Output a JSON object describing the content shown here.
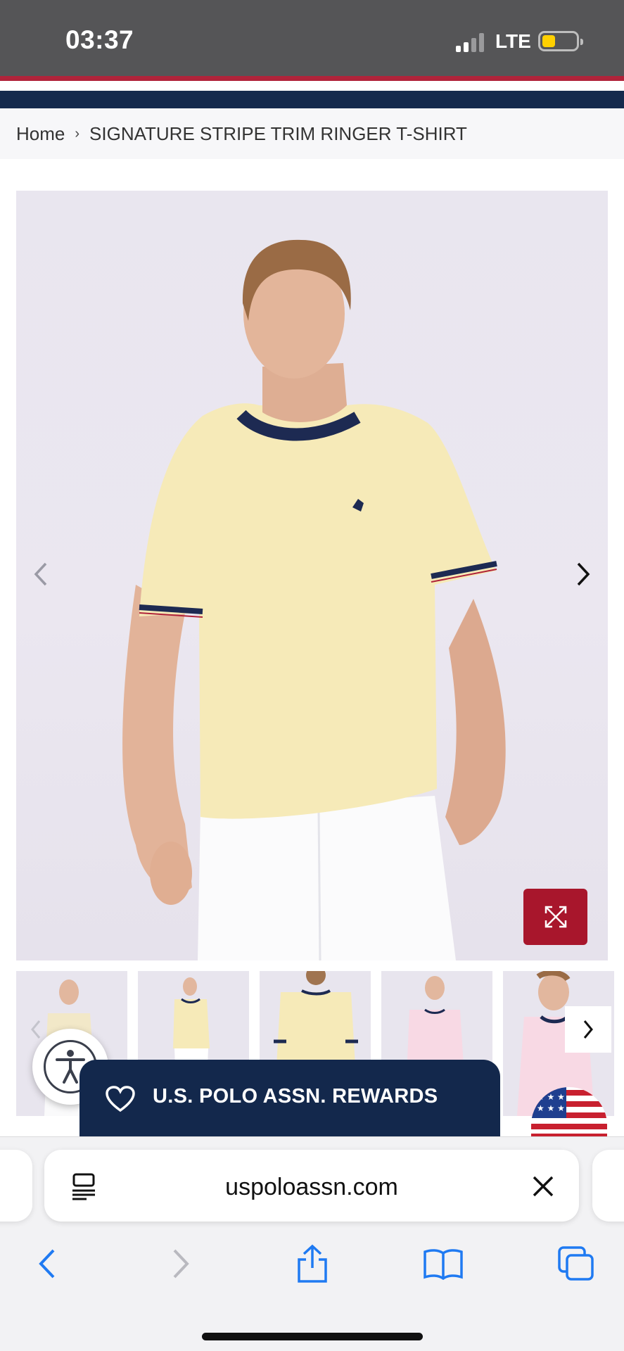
{
  "status_bar": {
    "time": "03:37",
    "carrier": "LTE",
    "battery_level": 0.4
  },
  "breadcrumb": {
    "home": "Home",
    "separator": "›",
    "current": "SIGNATURE STRIPE TRIM RINGER T-SHIRT"
  },
  "gallery": {
    "thumbnail_count": 5
  },
  "rewards": {
    "label": "U.S. POLO ASSN. REWARDS"
  },
  "browser": {
    "url": "uspoloassn.com"
  },
  "colors": {
    "brand_navy": "#13284c",
    "brand_red": "#a8162c",
    "shirt_yellow": "#f6eab8",
    "ios_blue": "#1f7af2"
  },
  "icons": {
    "hero_prev": "chevron-left-icon",
    "hero_next": "chevron-right-icon",
    "zoom": "expand-icon",
    "accessibility": "accessibility-icon",
    "rewards": "heart-icon",
    "reader": "reader-mode-icon",
    "clear": "close-icon",
    "back": "back-icon",
    "forward": "forward-icon",
    "share": "share-icon",
    "bookmarks": "bookmarks-icon",
    "tabs": "tabs-icon"
  }
}
